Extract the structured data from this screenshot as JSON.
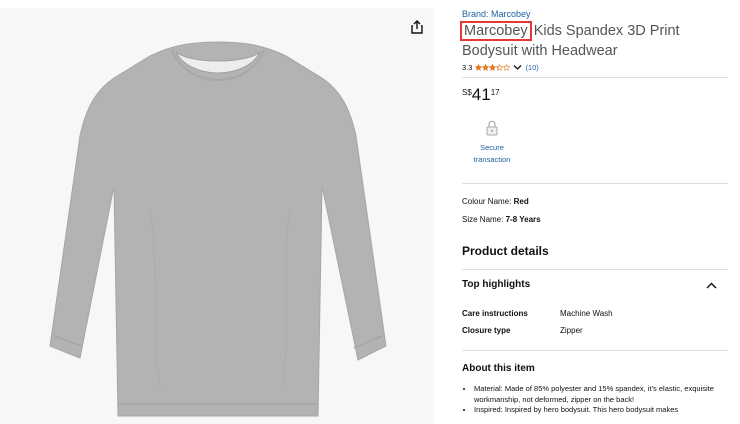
{
  "brand_line": "Brand: Marcobey",
  "title": {
    "brand": "Marcobey",
    "rest": " Kids Spandex 3D Print Bodysuit with Headwear"
  },
  "rating": {
    "value": "3.3",
    "stars": 3.3,
    "count": "(10)"
  },
  "price": {
    "currency": "S$",
    "whole": "41",
    "fraction": "17"
  },
  "secure": {
    "line1": "Secure",
    "line2": "transaction"
  },
  "attributes": {
    "colour_label": "Colour Name:",
    "colour_value": "Red",
    "size_label": "Size Name:",
    "size_value": "7-8 Years"
  },
  "product_details": {
    "heading": "Product details",
    "top_highlights": "Top highlights",
    "specs": [
      {
        "label": "Care instructions",
        "value": "Machine Wash"
      },
      {
        "label": "Closure type",
        "value": "Zipper"
      }
    ]
  },
  "about": {
    "heading": "About this item",
    "bullets": [
      "Material: Made of 85% polyester and 15% spandex, it's elastic, exquisite workmanship, not deformed, zipper on the back!",
      "Inspired: Inspired by hero bodysuit. This hero bodysuit makes"
    ]
  },
  "colors": {
    "link": "#2162a1",
    "star": "#de7921",
    "highlight_box": "#e53935",
    "image_bg": "#f7f7f7",
    "shirt": "#b3b3b3"
  },
  "icons": {
    "share": "share-icon",
    "lock": "lock-icon",
    "chevron_down": "chevron-down-icon",
    "chevron_up": "chevron-up-icon",
    "star": "star-icon"
  }
}
